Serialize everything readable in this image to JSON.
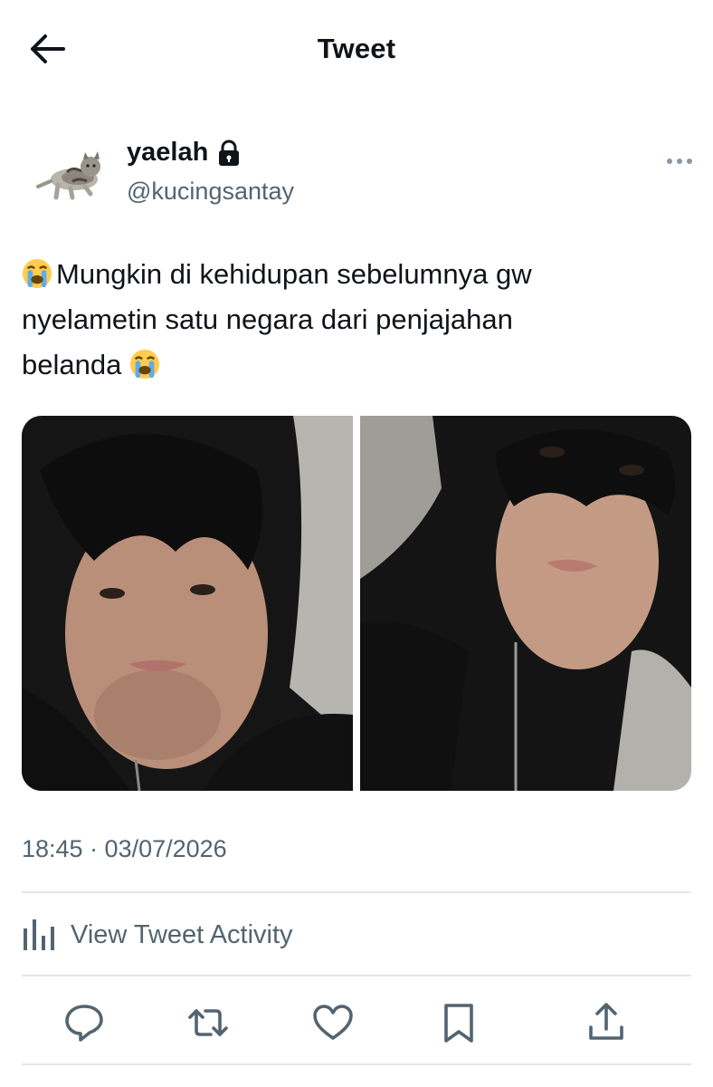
{
  "header": {
    "title": "Tweet",
    "back_icon": "arrow-left-icon"
  },
  "tweet": {
    "author": {
      "display_name": "yaelah",
      "handle": "@kucingsantay",
      "protected_icon": "lock-icon",
      "avatar": "cat-avatar"
    },
    "text_lines": [
      "Mungkin di kehidupan sebelumnya gw",
      "nyelametin satu negara dari penjajahan",
      "belanda"
    ],
    "emoji": "loudly-crying-face",
    "media_count": 2,
    "timestamp": "18:45 · 03/07/2026",
    "activity_label": "View Tweet Activity"
  },
  "actions": [
    "reply-icon",
    "retweet-icon",
    "like-icon",
    "bookmark-icon",
    "share-icon"
  ],
  "colors": {
    "text": "#0f1419",
    "secondary": "#536471",
    "divider": "#e3e6e8"
  }
}
